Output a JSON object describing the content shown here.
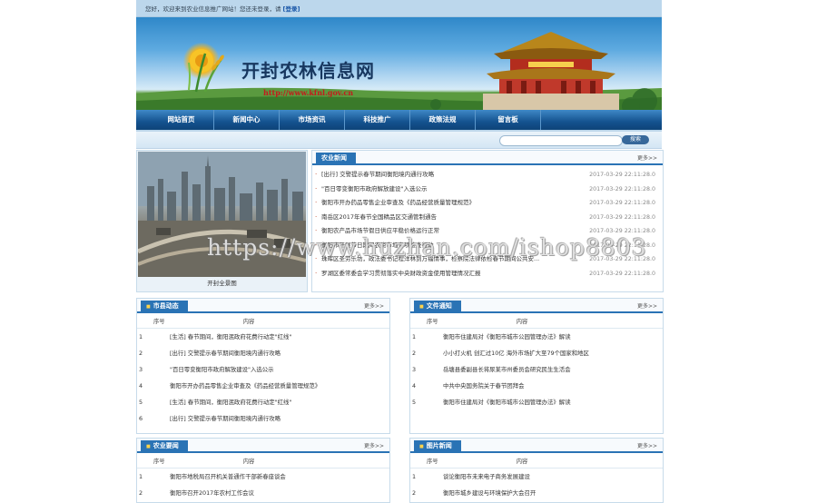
{
  "topbar": {
    "welcome": "您好，欢迎来到农业信息推广网站！您还未登录，请",
    "login_label": "[登录]"
  },
  "header": {
    "site_name": "开封农林信息网",
    "site_url": "http://www.kfnl.gov.cn"
  },
  "nav": {
    "items": [
      "网站首页",
      "新闻中心",
      "市场资讯",
      "科技推广",
      "政策法规",
      "留言板"
    ]
  },
  "search": {
    "placeholder": "",
    "button_label": "搜索"
  },
  "featured": {
    "caption": "开封全景图"
  },
  "agri_news": {
    "title": "农业新闻",
    "more": "更多>>",
    "items": [
      {
        "text": "[出行] 交警提示春节期间衡阳境内通行攻略",
        "date": "2017-03-29 22:11:28.0"
      },
      {
        "text": "\"百日零变衡阳市政府解放建设\"入选公示",
        "date": "2017-03-29 22:11:28.0"
      },
      {
        "text": "衡阳市开办药品零售企业审查及《药品经营质量管理规范》",
        "date": "2017-03-29 22:11:28.0"
      },
      {
        "text": "南岳区2017年春节全国精品区交通管制通告",
        "date": "2017-03-29 22:11:28.0"
      },
      {
        "text": "衡阳农产品市场节假日供应平稳价格运行正常",
        "date": "2017-03-29 22:11:28.0"
      },
      {
        "text": "衡阳市开展节日期间农资市场专项检查行动",
        "date": "2017-03-29 22:11:28.0"
      },
      {
        "text": "珠晖区圣劳乐坊，政法委书记程洋林到万福情事，检察院法律依检春节期间公共安...",
        "date": "2017-03-29 22:11:28.0"
      },
      {
        "text": "罗湖区委常委会学习贯彻落实中央财政资金使用管理情况汇报",
        "date": "2017-03-29 22:11:28.0"
      }
    ]
  },
  "county_news": {
    "title": "市县动态",
    "more": "更多>>",
    "col_no": "序号",
    "col_content": "内容",
    "rows": [
      {
        "no": "1",
        "text": "[生活] 春节期间，衡阳泯政府花费行动定\"红线\""
      },
      {
        "no": "2",
        "text": "[出行] 交警提示春节期间衡阳境内通行攻略"
      },
      {
        "no": "3",
        "text": "\"百日零变衡阳市政府解放建设\"入选公示"
      },
      {
        "no": "4",
        "text": "衡阳市开办药品零售企业审查及《药品经营质量管理规范》"
      },
      {
        "no": "5",
        "text": "[生活] 春节期间，衡阳泯政府花费行动定\"红线\""
      },
      {
        "no": "6",
        "text": "[出行] 交警提示春节期间衡阳境内通行攻略"
      }
    ]
  },
  "file_notice": {
    "title": "文件通知",
    "more": "更多>>",
    "col_no": "序号",
    "col_content": "内容",
    "rows": [
      {
        "no": "1",
        "text": "衡阳市住建局对《衡阳市城市公园管理办法》解读"
      },
      {
        "no": "2",
        "text": "小小打火机 创汇过10亿 海外市场扩大至79个国家和地区"
      },
      {
        "no": "3",
        "text": "岳塘县委副县长将尿某市州委员会研究民生生活会"
      },
      {
        "no": "4",
        "text": "中共中央国务院关于春节团拜会"
      },
      {
        "no": "5",
        "text": "衡阳市住建局对《衡阳市城市公园管理办法》解读"
      }
    ]
  },
  "farm_news": {
    "title": "农业要闻",
    "more": "更多>>",
    "col_no": "序号",
    "col_content": "内容",
    "rows": [
      {
        "no": "1",
        "text": "衡阳市地税局召开机关普通作干部新春座谈会"
      },
      {
        "no": "2",
        "text": "衡阳市召开2017年农村工作会议"
      }
    ]
  },
  "photo_news": {
    "title": "图片新闻",
    "more": "更多>>",
    "col_no": "序号",
    "col_content": "内容",
    "rows": [
      {
        "no": "1",
        "text": "谈论衡阳市未来电子商务发展建设"
      },
      {
        "no": "2",
        "text": "衡阳市城乡建设与环境保护大会召开"
      }
    ]
  },
  "watermark": "https://www.huzhan.com/ishop8803"
}
